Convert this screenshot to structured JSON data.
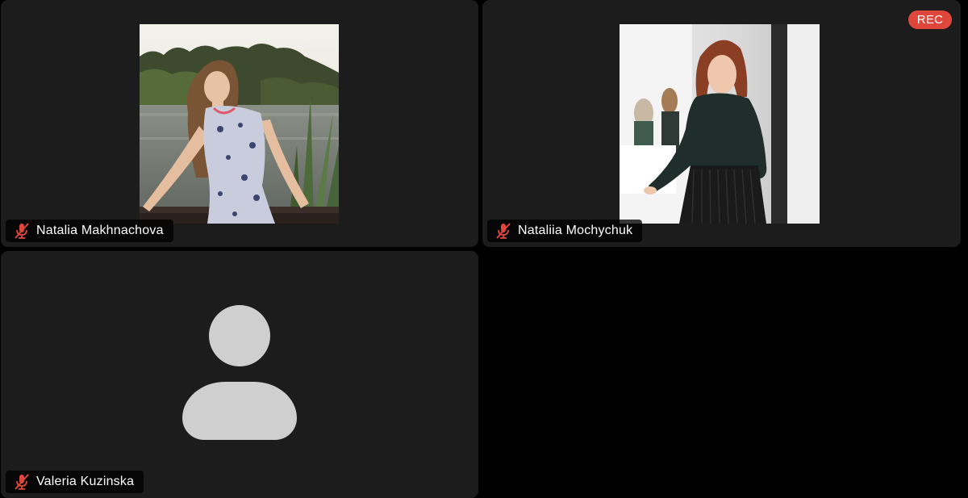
{
  "recording": {
    "label": "REC",
    "color": "#e0473c"
  },
  "participants": [
    {
      "name": "Natalia Makhnachova",
      "muted": true,
      "video": "photo",
      "icon": "muted-microphone-icon"
    },
    {
      "name": "Nataliia Mochychuk",
      "muted": true,
      "video": "photo",
      "icon": "muted-microphone-icon"
    },
    {
      "name": "Valeria Kuzinska",
      "muted": true,
      "video": "avatar-placeholder",
      "icon": "muted-microphone-icon"
    }
  ],
  "colors": {
    "tile_background": "#1c1c1c",
    "page_background": "#000000",
    "muted_icon": "#e0473c",
    "avatar_placeholder": "#cfcfcf"
  }
}
